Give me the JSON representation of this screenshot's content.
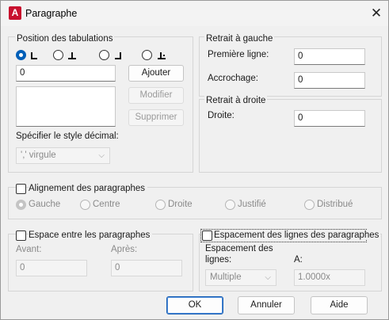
{
  "window": {
    "title": "Paragraphe",
    "icon": "autocad-app-icon",
    "close_label": "✕"
  },
  "tabs_section": {
    "title": "Position des tabulations",
    "tab_types": [
      {
        "name": "left-tab",
        "selected": true
      },
      {
        "name": "center-tab",
        "selected": false
      },
      {
        "name": "right-tab",
        "selected": false
      },
      {
        "name": "decimal-tab",
        "selected": false
      }
    ],
    "position_value": "0",
    "add_label": "Ajouter",
    "modify_label": "Modifier",
    "delete_label": "Supprimer",
    "decimal_style_label": "Spécifier le style décimal:",
    "decimal_style_value": "',' virgule"
  },
  "left_indent": {
    "title": "Retrait à gauche",
    "first_line_label": "Première ligne:",
    "first_line_value": "0",
    "hanging_label": "Accrochage:",
    "hanging_value": "0"
  },
  "right_indent": {
    "title": "Retrait à droite",
    "right_label": "Droite:",
    "right_value": "0"
  },
  "alignment": {
    "checkbox_label": "Alignement des paragraphes",
    "options": [
      "Gauche",
      "Centre",
      "Droite",
      "Justifié",
      "Distribué"
    ],
    "selected": "Gauche"
  },
  "spacing": {
    "checkbox_label": "Espace entre les paragraphes",
    "before_label": "Avant:",
    "before_value": "0",
    "after_label": "Après:",
    "after_value": "0"
  },
  "line_spacing": {
    "checkbox_label": "Espacement des lignes des paragraphes",
    "spacing_label_line1": "Espacement des",
    "spacing_label_line2": "lignes:",
    "spacing_value": "Multiple",
    "at_label": "A:",
    "at_value": "1.0000x"
  },
  "buttons": {
    "ok": "OK",
    "cancel": "Annuler",
    "help": "Aide"
  }
}
